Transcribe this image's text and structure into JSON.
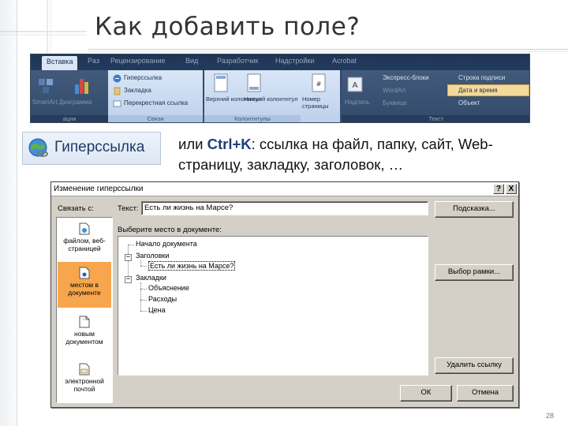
{
  "slide": {
    "title": "Как добавить поле?",
    "description_prefix": "или ",
    "description_key": "Ctrl+K",
    "description_rest": ": ссылка на файл, папку, сайт, Web-страницу, закладку, заголовок, …",
    "page_number": "28"
  },
  "ribbon": {
    "tabs": [
      "Вставка",
      "Рaз",
      "Рецензирование",
      "Вид",
      "Разработчик",
      "Надстройки",
      "Acrobat"
    ],
    "groups": {
      "illustrations_label": "SmartArt Диаграмма",
      "illustrations_group": "ации",
      "links_items": [
        "Гиперссылка",
        "Закладка",
        "Перекрестная ссылка"
      ],
      "links_group": "Связи",
      "header_footer_items": [
        "Верхний колонтитул",
        "Нижний колонтитул",
        "Номер страницы"
      ],
      "header_footer_group": "Колонтитулы",
      "text_items": [
        "Надпись",
        "Экспресс-блоки",
        "WordArt",
        "Буквица",
        "Строка подписи",
        "Дата и время",
        "Объект"
      ],
      "text_group": "Текст"
    }
  },
  "hyperlink_button": {
    "label": "Гиперссылка",
    "icon": "globe-link-icon"
  },
  "dialog": {
    "title": "Изменение гиперссылки",
    "help_button": "?",
    "close_button": "X",
    "link_to_label": "Связать с:",
    "text_label": "Текст:",
    "text_value": "Есть ли жизнь на Марсе?",
    "tooltip_button": "Подсказка...",
    "select_place_label": "Выберите место в документе:",
    "link_options": [
      {
        "label": "файлом, веб-страницей",
        "icon": "web-file-icon"
      },
      {
        "label": "местом в документе",
        "icon": "document-place-icon"
      },
      {
        "label": "новым документом",
        "icon": "new-document-icon"
      },
      {
        "label": "электронной почтой",
        "icon": "email-icon"
      }
    ],
    "tree": {
      "top": "Начало документа",
      "headings": "Заголовки",
      "heading_child": "Есть ли жизнь на Марсе?",
      "bookmarks": "Закладки",
      "bookmark_children": [
        "Объяснение",
        "Расходы",
        "Цена"
      ],
      "expanded_symbol": "−"
    },
    "frame_button": "Выбор рамки...",
    "remove_link_button": "Удалить ссылку",
    "ok_button": "ОК",
    "cancel_button": "Отмена"
  },
  "colors": {
    "title": "#333333",
    "key_text": "#1f3f7a",
    "active_option": "#f7a64e",
    "dialog_bg": "#d4d0c8"
  }
}
